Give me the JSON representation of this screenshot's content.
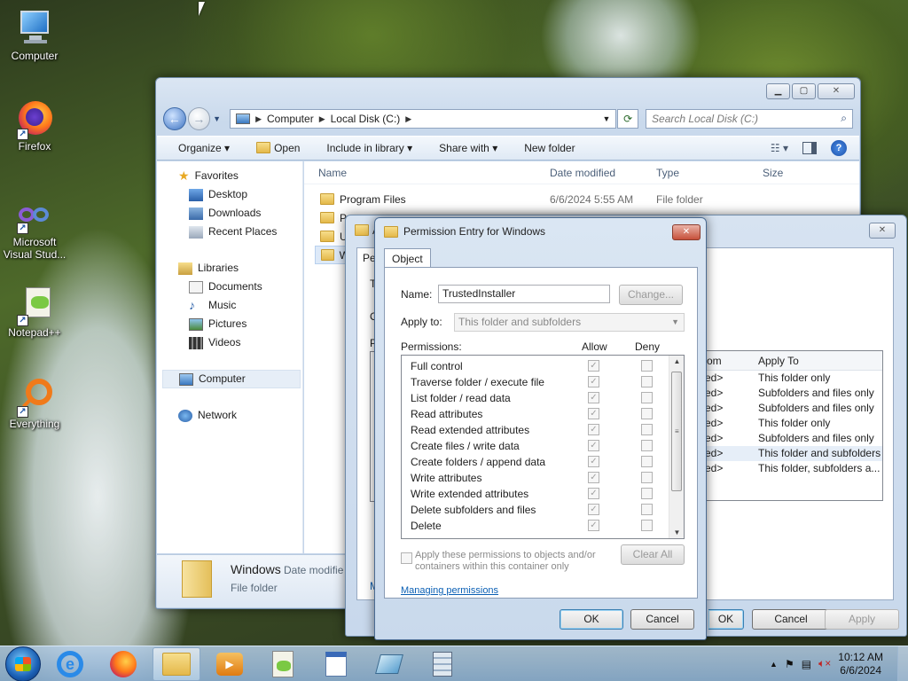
{
  "desktop": {
    "icons": [
      {
        "label": "Computer"
      },
      {
        "label": "Firefox"
      },
      {
        "label": "Microsoft Visual Stud..."
      },
      {
        "label": "Notepad++"
      },
      {
        "label": "Everything"
      }
    ]
  },
  "explorer": {
    "address": {
      "computer": "Computer",
      "disk": "Local Disk (C:)"
    },
    "search_placeholder": "Search Local Disk (C:)",
    "toolbar": {
      "organize": "Organize",
      "open": "Open",
      "include": "Include in library",
      "share": "Share with",
      "new_folder": "New folder"
    },
    "nav": {
      "favorites": "Favorites",
      "desktop": "Desktop",
      "downloads": "Downloads",
      "recent": "Recent Places",
      "libraries": "Libraries",
      "documents": "Documents",
      "music": "Music",
      "pictures": "Pictures",
      "videos": "Videos",
      "computer": "Computer",
      "network": "Network"
    },
    "columns": {
      "name": "Name",
      "date": "Date modified",
      "type": "Type",
      "size": "Size"
    },
    "rows": [
      {
        "name": "Program Files",
        "date": "6/6/2024 5:55 AM",
        "type": "File folder"
      },
      {
        "name": "Pr"
      },
      {
        "name": "U"
      },
      {
        "name": "W"
      }
    ],
    "details": {
      "name": "Windows",
      "date_label": "Date modifie",
      "type": "File folder"
    }
  },
  "security_dialog": {
    "title_partial": "A",
    "tab_partial": "Pe",
    "letter_t": "T",
    "letter_o": "O",
    "letter_p": "P",
    "link_partial": "M",
    "columns": {
      "from": "om",
      "apply_to": "Apply To"
    },
    "rows": [
      {
        "from": "ed>",
        "apply_to": "This folder only"
      },
      {
        "from": "ed>",
        "apply_to": "Subfolders and files only"
      },
      {
        "from": "ed>",
        "apply_to": "Subfolders and files only"
      },
      {
        "from": "ed>",
        "apply_to": "This folder only"
      },
      {
        "from": "ed>",
        "apply_to": "Subfolders and files only"
      },
      {
        "from": "ed>",
        "apply_to": "This folder and subfolders"
      },
      {
        "from": "ed>",
        "apply_to": "This folder, subfolders a..."
      }
    ],
    "buttons": {
      "ok": "OK",
      "cancel": "Cancel",
      "apply": "Apply"
    }
  },
  "permission_entry": {
    "title": "Permission Entry for Windows",
    "tab": "Object",
    "name_label": "Name:",
    "name_value": "TrustedInstaller",
    "change_button": "Change...",
    "apply_label": "Apply to:",
    "apply_value": "This folder and subfolders",
    "permissions_label": "Permissions:",
    "allow_label": "Allow",
    "deny_label": "Deny",
    "permissions": [
      {
        "name": "Full control",
        "allow": true,
        "deny": false
      },
      {
        "name": "Traverse folder / execute file",
        "allow": true,
        "deny": false
      },
      {
        "name": "List folder / read data",
        "allow": true,
        "deny": false
      },
      {
        "name": "Read attributes",
        "allow": true,
        "deny": false
      },
      {
        "name": "Read extended attributes",
        "allow": true,
        "deny": false
      },
      {
        "name": "Create files / write data",
        "allow": true,
        "deny": false
      },
      {
        "name": "Create folders / append data",
        "allow": true,
        "deny": false
      },
      {
        "name": "Write attributes",
        "allow": true,
        "deny": false
      },
      {
        "name": "Write extended attributes",
        "allow": true,
        "deny": false
      },
      {
        "name": "Delete subfolders and files",
        "allow": true,
        "deny": false
      },
      {
        "name": "Delete",
        "allow": true,
        "deny": false
      }
    ],
    "apply_children_text": "Apply these permissions to objects and/or containers within this container only",
    "clear_all": "Clear All",
    "managing_link": "Managing permissions",
    "ok": "OK",
    "cancel": "Cancel"
  },
  "taskbar": {
    "time": "10:12 AM",
    "date": "6/6/2024"
  }
}
